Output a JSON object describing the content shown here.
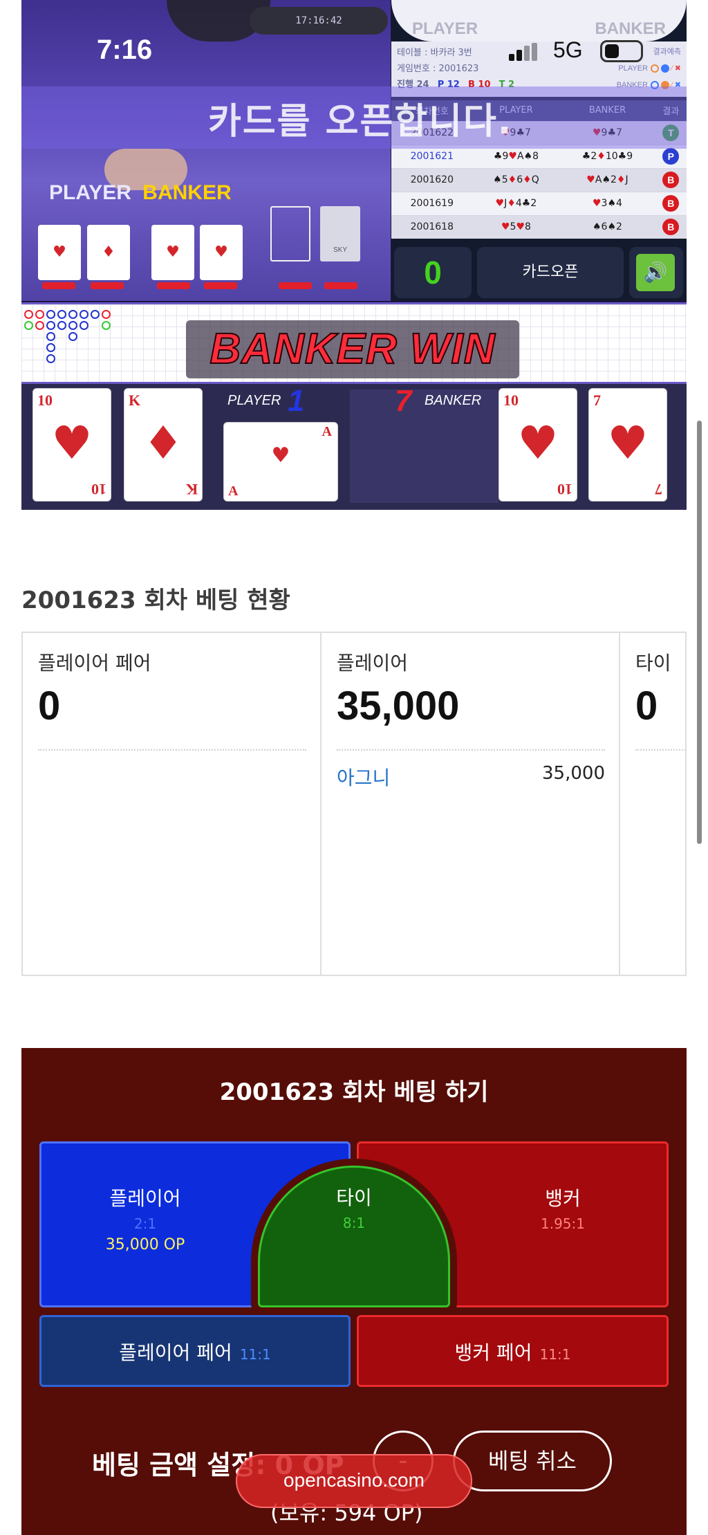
{
  "status_bar": {
    "time": "7:16",
    "network": "5G"
  },
  "video": {
    "announcement": "카드를 오픈합니다.",
    "table_labels": {
      "player": "PLAYER",
      "banker": "BANKER"
    },
    "clock": "17:16:42",
    "sky_card": "SKY",
    "win_banner": "BANKER WIN",
    "player_score": "1",
    "banker_score": "7",
    "player_label": "PLAYER",
    "banker_label": "BANKER",
    "player_cards": [
      {
        "rank": "10",
        "suit": "♥"
      },
      {
        "rank": "K",
        "suit": "♦"
      }
    ],
    "player_side_card": {
      "rank": "A",
      "suit": "♥"
    },
    "banker_cards": [
      {
        "rank": "10",
        "suit": "♥"
      },
      {
        "rank": "7",
        "suit": "♥"
      }
    ]
  },
  "stats_panel": {
    "header_player": "PLAYER",
    "header_banker": "BANKER",
    "table_line": "테이블 : 바카라 3번",
    "game_no_line": "게임번호 : 2001623",
    "progress": {
      "label": "진행 24",
      "p": "P 12",
      "b": "B 10",
      "t": "T 2"
    },
    "legend_result": "결과예측",
    "legend_player": "PLAYER",
    "legend_banker": "BANKER",
    "columns": [
      "회차번호",
      "PLAYER",
      "BANKER",
      "결과"
    ],
    "rows": [
      {
        "round": "2001622",
        "player": "♥9♣7",
        "banker": "♥9♣7",
        "result": "T",
        "color": "#3aa53a"
      },
      {
        "round": "2001621",
        "player": "♣9♥A♠8",
        "banker": "♣2♦10♣9",
        "result": "P",
        "color": "#2b3fd0"
      },
      {
        "round": "2001620",
        "player": "♠5♦6♦Q",
        "banker": "♥A♠2♦J",
        "result": "B",
        "color": "#d81b21"
      },
      {
        "round": "2001619",
        "player": "♥J♦4♣2",
        "banker": "♥3♠4",
        "result": "B",
        "color": "#d81b21"
      },
      {
        "round": "2001618",
        "player": "♥5♥8",
        "banker": "♠6♠2",
        "result": "B",
        "color": "#d81b21"
      }
    ],
    "counter": "0",
    "open_button": "카드오픈",
    "sound_icon": "speaker-icon"
  },
  "betting_status": {
    "title": "2001623 회차 베팅 현황",
    "columns": [
      {
        "label": "플레이어 페어",
        "amount": "0",
        "entries": []
      },
      {
        "label": "플레이어",
        "amount": "35,000",
        "entries": [
          {
            "user": "아그니",
            "amount": "35,000"
          }
        ]
      },
      {
        "label": "타이",
        "amount": "0",
        "entries": []
      }
    ]
  },
  "betting_panel": {
    "title": "2001623 회차 베팅 하기",
    "player": {
      "label": "플레이어",
      "odds": "2:1",
      "bet": "35,000 OP"
    },
    "tie": {
      "label": "타이",
      "odds": "8:1"
    },
    "banker": {
      "label": "뱅커",
      "odds": "1.95:1"
    },
    "player_pair": {
      "label": "플레이어 페어",
      "odds": "11:1"
    },
    "banker_pair": {
      "label": "뱅커 페어",
      "odds": "11:1"
    },
    "amount_setting": "베팅 금액 설정: 0 OP",
    "minus_symbol": "-",
    "cancel_button": "베팅 취소",
    "holding": "(보유: 594 OP)"
  },
  "url_pill": "opencasino.com"
}
